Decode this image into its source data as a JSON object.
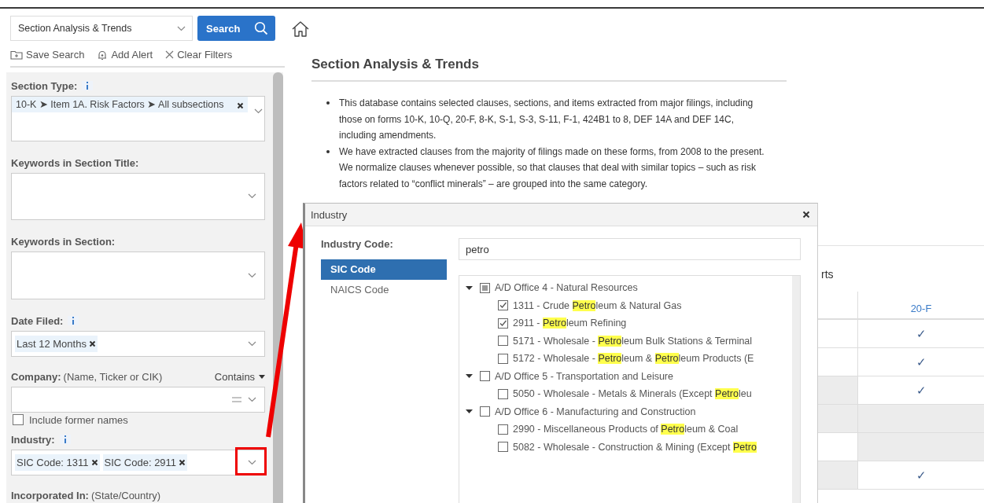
{
  "header": {
    "database_select": "Section Analysis & Trends",
    "search_button": "Search"
  },
  "actions": [
    {
      "kind": "save",
      "label": "Save Search"
    },
    {
      "kind": "alert",
      "label": "Add Alert"
    },
    {
      "kind": "clear",
      "label": "Clear Filters"
    }
  ],
  "filters": [
    {
      "kind": "chip-area",
      "label": "Section Type:",
      "info": true,
      "chips": [
        "10-K ➤ Item 1A. Risk Factors ➤ All subsections"
      ]
    },
    {
      "kind": "text-area",
      "label": "Keywords in Section Title:",
      "info": false
    },
    {
      "kind": "text-area",
      "label": "Keywords in Section:",
      "info": false
    },
    {
      "kind": "select",
      "label": "Date Filed:",
      "info": true,
      "chips": [
        "Last 12 Months"
      ],
      "highlighted": false
    },
    {
      "kind": "company",
      "label": "Company:",
      "hint": "(Name, Ticker or CIK)",
      "mode": "Contains",
      "info": false
    },
    {
      "kind": "checkbox",
      "label": "Include former names",
      "checked": false
    },
    {
      "kind": "select",
      "label": "Industry:",
      "info": true,
      "chips": [
        "SIC Code: 1311",
        "SIC Code: 2911"
      ],
      "highlighted": true
    },
    {
      "kind": "label-only",
      "label": "Incorporated In:",
      "hint": "(State/Country)",
      "info": false
    }
  ],
  "main": {
    "title": "Section Analysis & Trends",
    "bullets": [
      "This database contains selected clauses, sections, and items extracted from major filings, including those on forms 10-K, 10-Q, 20-F, 8-K, S-1, S-3, S-11, F-1, 424B1 to 8, DEF 14A and DEF 14C, including amendments.",
      "We have extracted clauses from the majority of filings made on these forms, from 2008 to the present. We normalize clauses whenever possible, so that clauses that deal with similar topics – such as risk factors related to “conflict minerals” – are grouped into the same category."
    ],
    "reports": {
      "heading": "rts",
      "column_2": {
        "label": "20-F"
      },
      "rows": [
        {
          "cells": [
            {
              "shaded": false
            },
            {
              "shaded": false,
              "text": "✓"
            }
          ]
        },
        {
          "cells": [
            {
              "shaded": false
            },
            {
              "shaded": false,
              "text": "✓"
            }
          ]
        },
        {
          "cells": [
            {
              "shaded": true
            },
            {
              "shaded": false,
              "text": "✓"
            }
          ]
        },
        {
          "cells": [
            {
              "shaded": true
            },
            {
              "shaded": true
            }
          ]
        },
        {
          "cells": [
            {
              "shaded": false
            },
            {
              "shaded": true
            }
          ]
        },
        {
          "cells": [
            {
              "shaded": true
            },
            {
              "shaded": false,
              "text": "✓"
            }
          ]
        }
      ]
    }
  },
  "callout_arrow": true,
  "modal": {
    "title": "Industry",
    "code_label": "Industry Code:",
    "code_types": [
      {
        "label": "SIC Code",
        "selected": true
      },
      {
        "label": "NAICS Code",
        "selected": false
      }
    ],
    "search_value": "petro",
    "tree": [
      {
        "label": [
          {
            "text": "A/D Office 4 - Natural Resources"
          }
        ],
        "checked": false,
        "partial": true,
        "expanded": true,
        "children": [
          {
            "label": [
              {
                "text": "1311 - Crude "
              },
              {
                "text": "Petro",
                "match": true
              },
              {
                "text": "leum & Natural Gas"
              }
            ],
            "checked": true,
            "partial": false
          },
          {
            "label": [
              {
                "text": "2911 - "
              },
              {
                "text": "Petro",
                "match": true
              },
              {
                "text": "leum Refining"
              }
            ],
            "checked": true,
            "partial": false
          },
          {
            "label": [
              {
                "text": "5171 - Wholesale - "
              },
              {
                "text": "Petro",
                "match": true
              },
              {
                "text": "leum Bulk Stations & Terminal"
              }
            ],
            "checked": false,
            "partial": false
          },
          {
            "label": [
              {
                "text": "5172 - Wholesale - "
              },
              {
                "text": "Petro",
                "match": true
              },
              {
                "text": "leum & "
              },
              {
                "text": "Petro",
                "match": true
              },
              {
                "text": "leum Products (E"
              }
            ],
            "checked": false,
            "partial": false
          }
        ]
      },
      {
        "label": [
          {
            "text": "A/D Office 5 - Transportation and Leisure"
          }
        ],
        "checked": false,
        "partial": false,
        "expanded": true,
        "children": [
          {
            "label": [
              {
                "text": "5050 - Wholesale - Metals & Minerals (Except "
              },
              {
                "text": "Petro",
                "match": true
              },
              {
                "text": "leu"
              }
            ],
            "checked": false,
            "partial": false
          }
        ]
      },
      {
        "label": [
          {
            "text": "A/D Office 6 - Manufacturing and Construction"
          }
        ],
        "checked": false,
        "partial": false,
        "expanded": true,
        "children": [
          {
            "label": [
              {
                "text": "2990 - Miscellaneous Products of "
              },
              {
                "text": "Petro",
                "match": true
              },
              {
                "text": "leum & Coal"
              }
            ],
            "checked": false,
            "partial": false
          },
          {
            "label": [
              {
                "text": "5082 - Wholesale - Construction & Mining (Except "
              },
              {
                "text": "Petro",
                "match": true
              }
            ],
            "checked": false,
            "partial": false
          }
        ]
      }
    ]
  }
}
